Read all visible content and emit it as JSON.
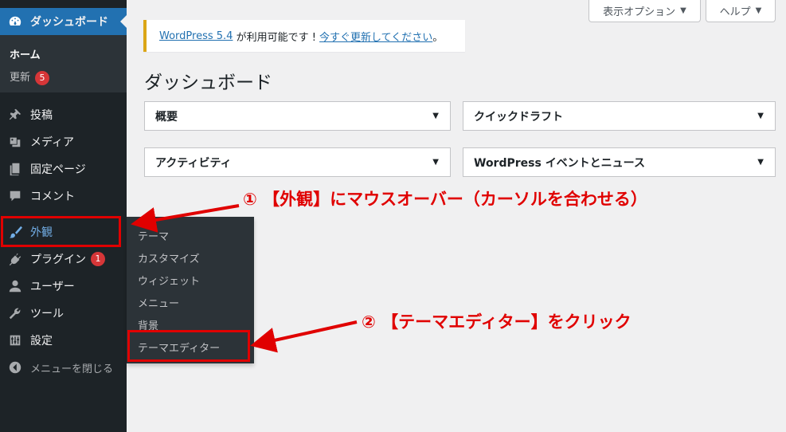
{
  "sidebar": {
    "dashboard": "ダッシュボード",
    "dashboard_submenu": {
      "home": "ホーム",
      "updates": "更新",
      "updates_count": "5"
    },
    "items": [
      {
        "label": "投稿",
        "icon": "pin-icon"
      },
      {
        "label": "メディア",
        "icon": "media-icon"
      },
      {
        "label": "固定ページ",
        "icon": "page-icon"
      },
      {
        "label": "コメント",
        "icon": "comment-icon"
      },
      {
        "label": "外観",
        "icon": "brush-icon"
      },
      {
        "label": "プラグイン",
        "icon": "plugin-icon",
        "badge": "1"
      },
      {
        "label": "ユーザー",
        "icon": "user-icon"
      },
      {
        "label": "ツール",
        "icon": "wrench-icon"
      },
      {
        "label": "設定",
        "icon": "settings-icon"
      }
    ],
    "collapse": "メニューを閉じる"
  },
  "flyout": {
    "items": [
      "テーマ",
      "カスタマイズ",
      "ウィジェット",
      "メニュー",
      "背景",
      "テーマエディター"
    ]
  },
  "header": {
    "screen_options": "表示オプション",
    "help": "ヘルプ",
    "caret": "▼"
  },
  "notice": {
    "link1": "WordPress 5.4",
    "middle": " が利用可能です ! ",
    "link2": "今すぐ更新してください",
    "end": "。"
  },
  "page_title": "ダッシュボード",
  "widgets": [
    "概要",
    "クイックドラフト",
    "アクティビティ",
    "WordPress イベントとニュース"
  ],
  "annotations": {
    "step1": "① 【外観】にマウスオーバー（カーソルを合わせる）",
    "step2": "② 【テーマエディター】をクリック"
  },
  "colors": {
    "accent": "#2271b1",
    "annotation": "#e00000",
    "sidebar_bg": "#1d2327",
    "notice_border": "#dba617"
  }
}
